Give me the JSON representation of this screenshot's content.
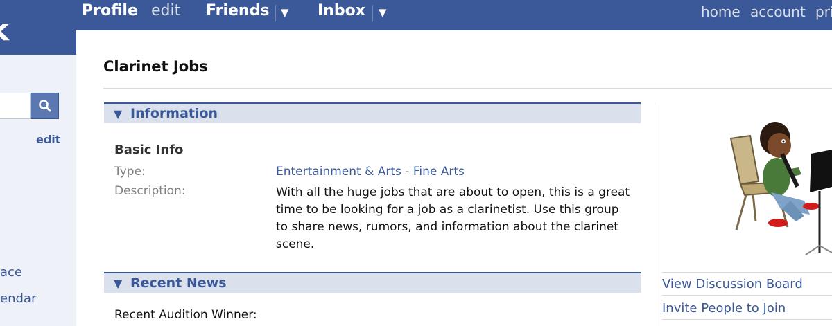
{
  "nav": {
    "logo_fragment": "k",
    "profile": "Profile",
    "edit": "edit",
    "friends": "Friends",
    "inbox": "Inbox",
    "home": "home",
    "account": "account",
    "privacy_fragment": "pri"
  },
  "sidebar": {
    "edit": "edit",
    "links": [
      "ace",
      "endar"
    ]
  },
  "group": {
    "title": "Clarinet Jobs",
    "sections": {
      "information": "Information",
      "recent_news": "Recent News"
    },
    "basic_info": {
      "heading": "Basic Info",
      "type_label": "Type:",
      "type_category": "Entertainment & Arts",
      "type_separator": " - ",
      "type_subcategory": "Fine Arts",
      "description_label": "Description:",
      "description": "With all the huge jobs that are about to open, this is a great time to be looking for a job as a clarinetist. Use this group to share news, rumors, and information about the clarinet scene."
    },
    "recent_news_text": "Recent Audition Winner:"
  },
  "actions": {
    "view_discussion_board": "View Discussion Board",
    "invite_people": "Invite People to Join"
  },
  "colors": {
    "brand_blue": "#3b5998",
    "section_bg": "#dbe1ec",
    "link": "#3b5998"
  },
  "icons": {
    "search": "magnifier",
    "dropdown": "triangle-down",
    "section_toggle": "triangle-down"
  }
}
